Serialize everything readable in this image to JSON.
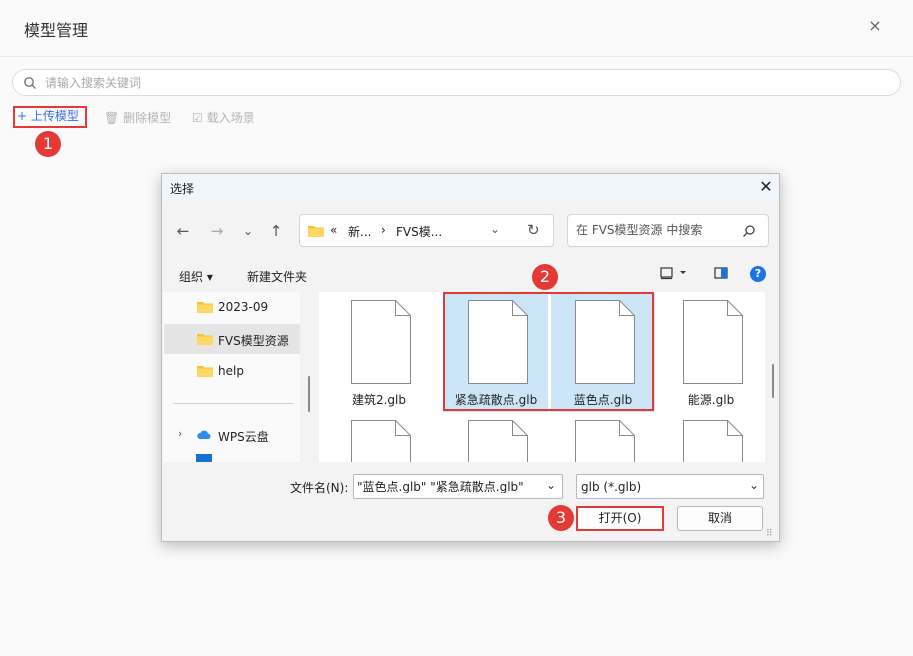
{
  "panel": {
    "title": "模型管理",
    "close_label": "×",
    "search_placeholder": "请输入搜索关键词"
  },
  "toolbar": {
    "upload_label": "+ 上传模型",
    "delete_label": "删除模型",
    "load_label": "载入场景"
  },
  "steps": [
    "1",
    "2",
    "3"
  ],
  "dialog": {
    "title": "选择",
    "close_label": "✕",
    "address": {
      "chevrons": "«",
      "crumb1": "新...",
      "separator": "›",
      "crumb2": "FVS模..."
    },
    "search_placeholder": "在 FVS模型资源 中搜索",
    "commands": {
      "organize": "组织 ▾",
      "new_folder": "新建文件夹"
    },
    "nav_items": [
      {
        "label": "2023-09"
      },
      {
        "label": "FVS模型资源"
      },
      {
        "label": "help"
      },
      {
        "label": "WPS云盘"
      }
    ],
    "files": [
      {
        "name": "建筑2.glb"
      },
      {
        "name": "紧急疏散点.glb"
      },
      {
        "name": "蓝色点.glb"
      },
      {
        "name": "能源.glb"
      }
    ],
    "filename_label": "文件名(N):",
    "filename_value": "\"蓝色点.glb\" \"紧急疏散点.glb\"",
    "filetype_value": "glb (*.glb)",
    "open_label": "打开(O)",
    "cancel_label": "取消"
  },
  "colors": {
    "accent_red": "#e53935",
    "link_blue": "#3a6ee8",
    "selection": "#cde6f7"
  }
}
